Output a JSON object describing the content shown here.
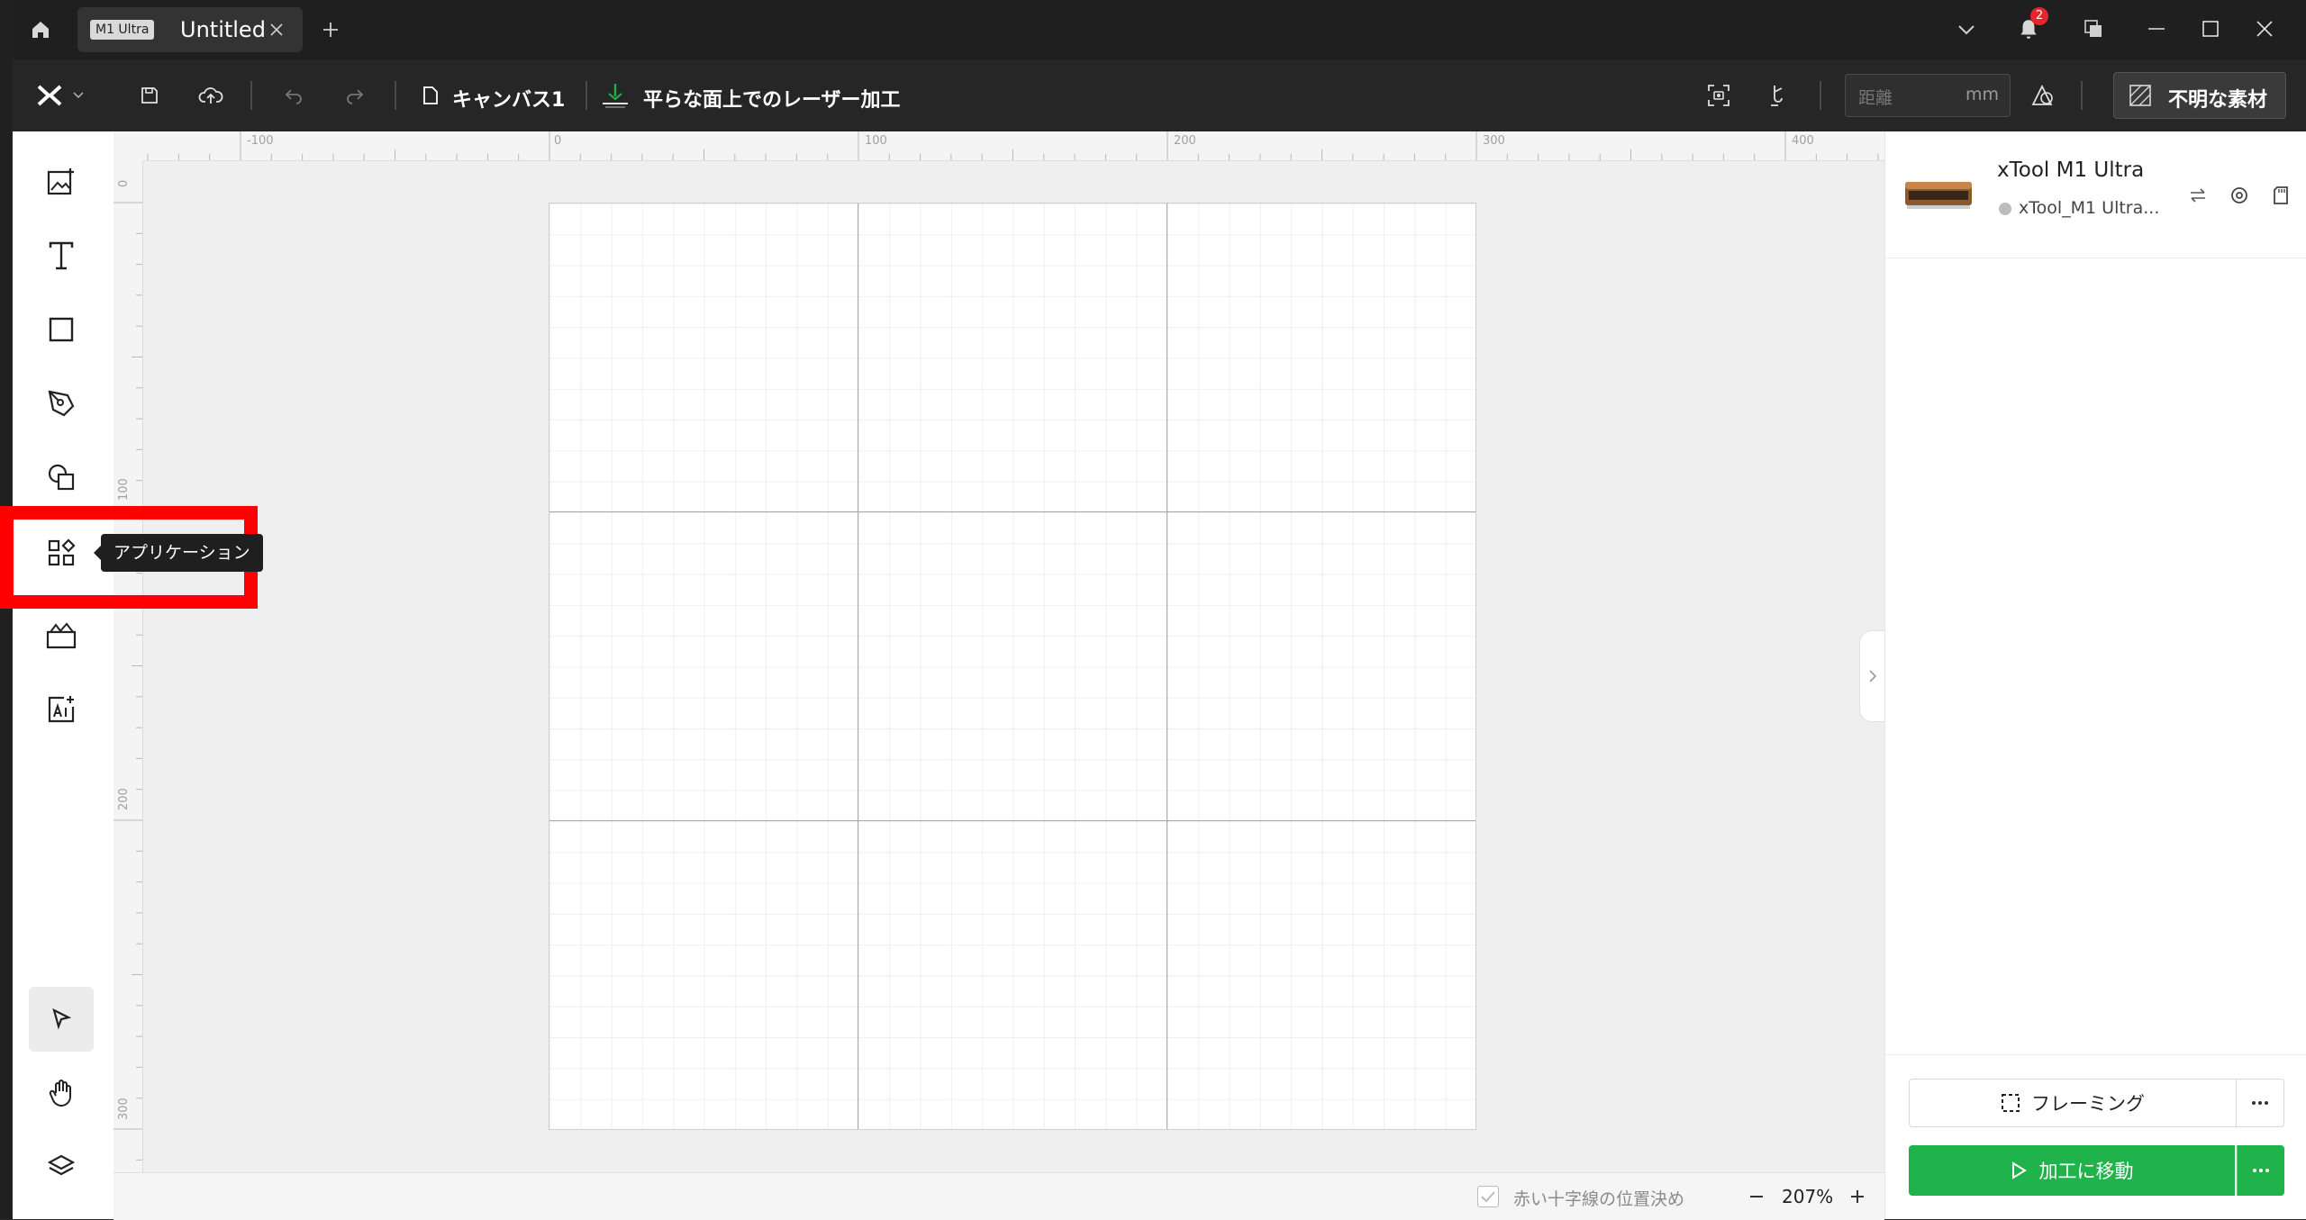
{
  "titlebar": {
    "tab_badge": "M1 Ultra",
    "tab_title": "Untitled",
    "notification_count": "2"
  },
  "toolbar": {
    "canvas_label": "キャンバス1",
    "mode_label": "平らな面上でのレーザー加工",
    "distance_placeholder": "距離",
    "distance_unit": "mm",
    "material_label": "不明な素材"
  },
  "sidebar": {
    "tooltip": "アプリケーション",
    "tools": [
      "image-add",
      "text",
      "rectangle",
      "pen",
      "shapes",
      "applications",
      "materials",
      "ai"
    ],
    "bottom_tools": [
      "select",
      "hand",
      "layers"
    ]
  },
  "rulers": {
    "top": [
      "-100",
      "0",
      "100",
      "200",
      "300",
      "400"
    ],
    "left": [
      "0",
      "100",
      "200",
      "300"
    ]
  },
  "device": {
    "name": "xTool M1 Ultra",
    "status_name": "xTool_M1 Ultra..."
  },
  "bottom": {
    "crosshair_label": "赤い十字線の位置決め",
    "zoom": "207%"
  },
  "actions": {
    "framing_label": "フレーミング",
    "process_label": "加工に移動"
  },
  "colors": {
    "accent_green": "#21b34b",
    "highlight_red": "#ff0000",
    "badge_red": "#e5262d"
  }
}
